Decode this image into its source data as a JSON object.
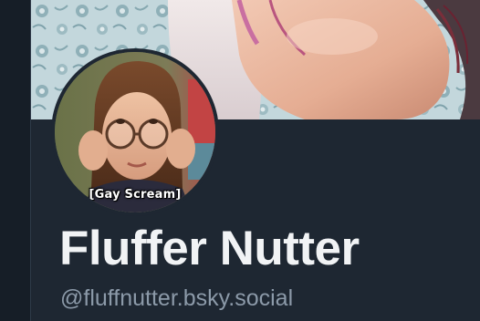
{
  "profile": {
    "avatar_caption": "[Gay Scream]",
    "display_name": "Fluffer Nutter",
    "handle": "@fluffnutter.bsky.social"
  },
  "colors": {
    "background": "#1e2732",
    "rail": "#161e27",
    "name_text": "#f1f3f5",
    "handle_text": "#8c9aa9"
  },
  "icons": {
    "banner": "banner-photo",
    "avatar": "avatar-photo"
  }
}
